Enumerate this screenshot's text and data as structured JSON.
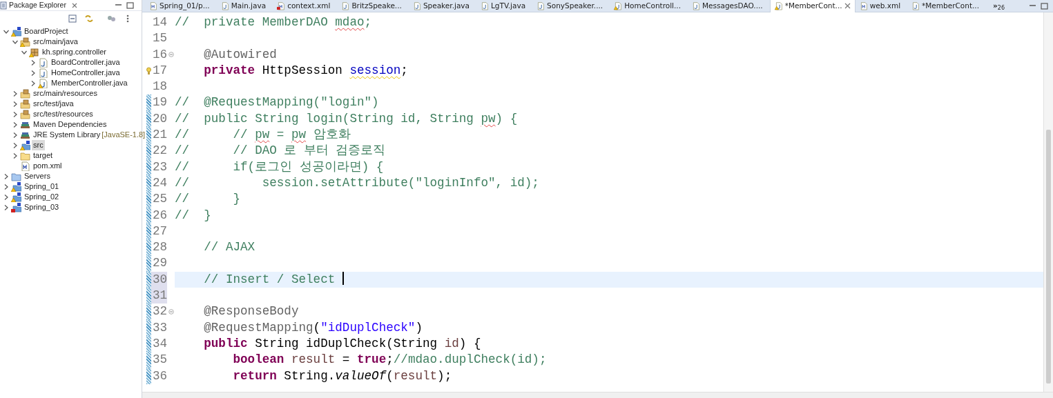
{
  "explorer": {
    "title": "Package Explorer",
    "tree": [
      {
        "label": "BoardProject",
        "kind": "project",
        "expanded": true,
        "selected": false,
        "warning": true,
        "error": false,
        "children": [
          {
            "label": "src/main/java",
            "kind": "source-folder",
            "expanded": true,
            "selected": false,
            "warning": true,
            "error": false,
            "children": [
              {
                "label": "kh.spring.controller",
                "kind": "package",
                "expanded": true,
                "selected": false,
                "warning": true,
                "error": false,
                "children": [
                  {
                    "label": "BoardController.java",
                    "kind": "java-file",
                    "expanded": false,
                    "selected": false,
                    "warning": false,
                    "error": false
                  },
                  {
                    "label": "HomeController.java",
                    "kind": "java-file",
                    "expanded": false,
                    "selected": false,
                    "warning": false,
                    "error": false
                  },
                  {
                    "label": "MemberController.java",
                    "kind": "java-file",
                    "expanded": false,
                    "selected": false,
                    "warning": true,
                    "error": false
                  }
                ]
              }
            ]
          },
          {
            "label": "src/main/resources",
            "kind": "source-folder",
            "expanded": false,
            "selected": false,
            "warning": false,
            "error": false
          },
          {
            "label": "src/test/java",
            "kind": "source-folder",
            "expanded": false,
            "selected": false,
            "warning": false,
            "error": false
          },
          {
            "label": "src/test/resources",
            "kind": "source-folder",
            "expanded": false,
            "selected": false,
            "warning": false,
            "error": false
          },
          {
            "label": "Maven Dependencies",
            "kind": "library",
            "expanded": false,
            "selected": false,
            "warning": false,
            "error": false
          },
          {
            "label": "JRE System Library",
            "decoration": "[JavaSE-1.8]",
            "kind": "library",
            "expanded": false,
            "selected": false,
            "warning": false,
            "error": false
          },
          {
            "label": "src",
            "kind": "project",
            "expanded": false,
            "selected": true,
            "warning": true,
            "error": false
          },
          {
            "label": "target",
            "kind": "folder",
            "expanded": false,
            "selected": false,
            "warning": false,
            "error": false
          },
          {
            "label": "pom.xml",
            "kind": "xml-file",
            "selected": false,
            "warning": false,
            "error": false
          }
        ]
      },
      {
        "label": "Servers",
        "kind": "server-folder",
        "expanded": false,
        "selected": false,
        "warning": false,
        "error": false
      },
      {
        "label": "Spring_01",
        "kind": "project",
        "expanded": false,
        "selected": false,
        "warning": true,
        "error": false
      },
      {
        "label": "Spring_02",
        "kind": "project",
        "expanded": false,
        "selected": false,
        "warning": true,
        "error": false
      },
      {
        "label": "Spring_03",
        "kind": "project",
        "expanded": false,
        "selected": false,
        "warning": false,
        "error": true
      }
    ]
  },
  "tabs": [
    {
      "label": "Spring_01/p...",
      "kind": "xml-file",
      "selected": false,
      "warning": false,
      "error": false
    },
    {
      "label": "Main.java",
      "kind": "java-file",
      "selected": false,
      "warning": false,
      "error": false
    },
    {
      "label": "context.xml",
      "kind": "xml-file",
      "selected": false,
      "warning": false,
      "error": true
    },
    {
      "label": "BritzSpeake...",
      "kind": "java-file",
      "selected": false,
      "warning": false,
      "error": false
    },
    {
      "label": "Speaker.java",
      "kind": "java-file",
      "selected": false,
      "warning": false,
      "error": false
    },
    {
      "label": "LgTV.java",
      "kind": "java-file",
      "selected": false,
      "warning": false,
      "error": false
    },
    {
      "label": "SonySpeaker....",
      "kind": "java-file",
      "selected": false,
      "warning": false,
      "error": false
    },
    {
      "label": "HomeControll...",
      "kind": "java-file",
      "selected": false,
      "warning": true,
      "error": false
    },
    {
      "label": "MessagesDAO....",
      "kind": "java-file",
      "selected": false,
      "warning": false,
      "error": false
    },
    {
      "label": "*MemberCont...",
      "kind": "java-file",
      "selected": true,
      "warning": true,
      "error": false
    },
    {
      "label": "web.xml",
      "kind": "xml-file",
      "selected": false,
      "warning": false,
      "error": false
    },
    {
      "label": "*MemberCont...",
      "kind": "java-file",
      "selected": false,
      "warning": false,
      "error": false
    }
  ],
  "overflow": {
    "chevron": "»",
    "count": "26"
  },
  "lines": [
    {
      "number": "14",
      "changed": false,
      "current": false,
      "ruler_selected": false,
      "caret": false,
      "fold": false,
      "quick_fix": false,
      "tokens": [
        {
          "kind": "comment",
          "text": "//  private MemberDAO "
        },
        {
          "kind": "comment-misspelled",
          "text": "mdao"
        },
        {
          "kind": "comment",
          "text": ";"
        }
      ]
    },
    {
      "number": "15",
      "changed": false,
      "current": false,
      "ruler_selected": false,
      "caret": false,
      "fold": false,
      "quick_fix": false
    },
    {
      "number": "16",
      "changed": false,
      "current": false,
      "ruler_selected": false,
      "caret": false,
      "fold": true,
      "quick_fix": false,
      "tokens": [
        {
          "kind": "annotation",
          "text": "    @Autowired"
        }
      ]
    },
    {
      "number": "17",
      "changed": false,
      "current": false,
      "ruler_selected": false,
      "caret": false,
      "fold": false,
      "quick_fix": true,
      "tokens": [
        {
          "kind": "keyword",
          "text": "    private"
        },
        {
          "kind": "plain",
          "text": " HttpSession "
        },
        {
          "kind": "field-warning",
          "text": "session"
        },
        {
          "kind": "plain",
          "text": ";"
        }
      ]
    },
    {
      "number": "18",
      "changed": false,
      "current": false,
      "ruler_selected": false,
      "caret": false,
      "fold": false,
      "quick_fix": false
    },
    {
      "number": "19",
      "changed": true,
      "current": false,
      "ruler_selected": false,
      "caret": false,
      "fold": false,
      "quick_fix": false,
      "tokens": [
        {
          "kind": "comment",
          "text": "//  @RequestMapping(\"login\")"
        }
      ]
    },
    {
      "number": "20",
      "changed": true,
      "current": false,
      "ruler_selected": false,
      "caret": false,
      "fold": false,
      "quick_fix": false,
      "tokens": [
        {
          "kind": "comment",
          "text": "//  public String login(String id, String "
        },
        {
          "kind": "comment-misspelled",
          "text": "pw"
        },
        {
          "kind": "comment",
          "text": ") {"
        }
      ]
    },
    {
      "number": "21",
      "changed": true,
      "current": false,
      "ruler_selected": false,
      "caret": false,
      "fold": false,
      "quick_fix": false,
      "tokens": [
        {
          "kind": "comment",
          "text": "//      // "
        },
        {
          "kind": "comment-misspelled",
          "text": "pw"
        },
        {
          "kind": "comment",
          "text": " = "
        },
        {
          "kind": "comment-misspelled",
          "text": "pw"
        },
        {
          "kind": "comment",
          "text": " 암호화"
        }
      ]
    },
    {
      "number": "22",
      "changed": true,
      "current": false,
      "ruler_selected": false,
      "caret": false,
      "fold": false,
      "quick_fix": false,
      "tokens": [
        {
          "kind": "comment",
          "text": "//      // DAO 로 부터 검증로직"
        }
      ]
    },
    {
      "number": "23",
      "changed": true,
      "current": false,
      "ruler_selected": false,
      "caret": false,
      "fold": false,
      "quick_fix": false,
      "tokens": [
        {
          "kind": "comment",
          "text": "//      if(로그인 성공이라면) {"
        }
      ]
    },
    {
      "number": "24",
      "changed": true,
      "current": false,
      "ruler_selected": false,
      "caret": false,
      "fold": false,
      "quick_fix": false,
      "tokens": [
        {
          "kind": "comment",
          "text": "//          session.setAttribute(\"loginInfo\", id);"
        }
      ]
    },
    {
      "number": "25",
      "changed": true,
      "current": false,
      "ruler_selected": false,
      "caret": false,
      "fold": false,
      "quick_fix": false,
      "tokens": [
        {
          "kind": "comment",
          "text": "//      }"
        }
      ]
    },
    {
      "number": "26",
      "changed": true,
      "current": false,
      "ruler_selected": false,
      "caret": false,
      "fold": false,
      "quick_fix": false,
      "tokens": [
        {
          "kind": "comment",
          "text": "//  }"
        }
      ]
    },
    {
      "number": "27",
      "changed": true,
      "current": false,
      "ruler_selected": false,
      "caret": false,
      "fold": false,
      "quick_fix": false
    },
    {
      "number": "28",
      "changed": true,
      "current": false,
      "ruler_selected": false,
      "caret": false,
      "fold": false,
      "quick_fix": false,
      "tokens": [
        {
          "kind": "comment",
          "text": "    // AJAX"
        }
      ]
    },
    {
      "number": "29",
      "changed": true,
      "current": false,
      "ruler_selected": false,
      "caret": false,
      "fold": false,
      "quick_fix": false
    },
    {
      "number": "30",
      "changed": true,
      "current": true,
      "ruler_selected": true,
      "caret": true,
      "fold": false,
      "quick_fix": false,
      "tokens": [
        {
          "kind": "comment",
          "text": "    // Insert / Select "
        }
      ]
    },
    {
      "number": "31",
      "changed": true,
      "current": false,
      "ruler_selected": true,
      "caret": false,
      "fold": false,
      "quick_fix": false
    },
    {
      "number": "32",
      "changed": true,
      "current": false,
      "ruler_selected": false,
      "caret": false,
      "fold": true,
      "quick_fix": false,
      "tokens": [
        {
          "kind": "annotation",
          "text": "    @ResponseBody"
        }
      ]
    },
    {
      "number": "33",
      "changed": true,
      "current": false,
      "ruler_selected": false,
      "caret": false,
      "fold": false,
      "quick_fix": false,
      "tokens": [
        {
          "kind": "annotation",
          "text": "    @RequestMapping"
        },
        {
          "kind": "plain",
          "text": "("
        },
        {
          "kind": "string",
          "text": "\"idDuplCheck\""
        },
        {
          "kind": "plain",
          "text": ")"
        }
      ]
    },
    {
      "number": "34",
      "changed": true,
      "current": false,
      "ruler_selected": false,
      "caret": false,
      "fold": false,
      "quick_fix": false,
      "tokens": [
        {
          "kind": "keyword",
          "text": "    public"
        },
        {
          "kind": "plain",
          "text": " String idDuplCheck(String "
        },
        {
          "kind": "local",
          "text": "id"
        },
        {
          "kind": "plain",
          "text": ") {"
        }
      ]
    },
    {
      "number": "35",
      "changed": true,
      "current": false,
      "ruler_selected": false,
      "caret": false,
      "fold": false,
      "quick_fix": false,
      "tokens": [
        {
          "kind": "keyword",
          "text": "        boolean"
        },
        {
          "kind": "local",
          "text": " result"
        },
        {
          "kind": "plain",
          "text": " = "
        },
        {
          "kind": "keyword",
          "text": "true"
        },
        {
          "kind": "plain",
          "text": ";"
        },
        {
          "kind": "comment",
          "text": "//mdao.duplCheck(id);"
        }
      ]
    },
    {
      "number": "36",
      "changed": true,
      "current": false,
      "ruler_selected": false,
      "caret": false,
      "fold": false,
      "quick_fix": false,
      "tokens": [
        {
          "kind": "keyword",
          "text": "        return"
        },
        {
          "kind": "plain",
          "text": " String."
        },
        {
          "kind": "italic",
          "text": "valueOf"
        },
        {
          "kind": "plain",
          "text": "("
        },
        {
          "kind": "local",
          "text": "result"
        },
        {
          "kind": "plain",
          "text": ");"
        }
      ]
    }
  ]
}
